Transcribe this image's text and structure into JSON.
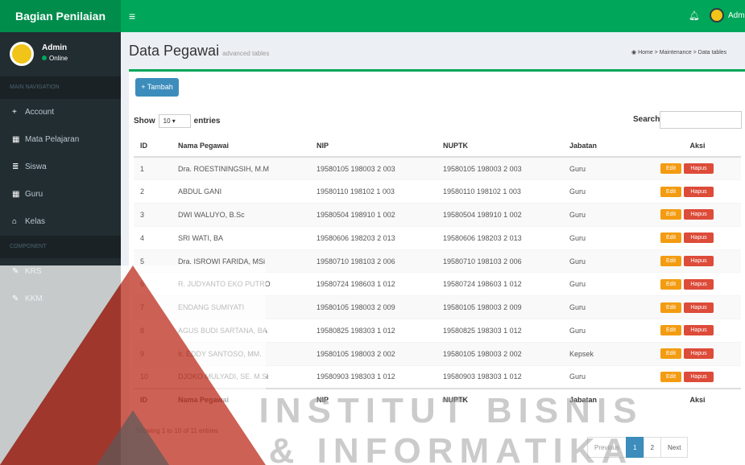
{
  "brand": "Bagian Penilaian",
  "top_user": "Admin",
  "sidebar": {
    "user_name": "Admin",
    "user_status": "Online",
    "header_main": "MAIN NAVIGATION",
    "header_component": "COMPONENT",
    "items": [
      {
        "label": "Account",
        "icon": "user-plus-icon",
        "glyph": "+"
      },
      {
        "label": "Mata Pelajaran",
        "icon": "table-icon",
        "glyph": "▦"
      },
      {
        "label": "Siswa",
        "icon": "list-icon",
        "glyph": "≣"
      },
      {
        "label": "Guru",
        "icon": "grid-icon",
        "glyph": "▦"
      },
      {
        "label": "Kelas",
        "icon": "home-icon",
        "glyph": "⌂"
      },
      {
        "label": "KRS",
        "icon": "edit-icon",
        "glyph": "✎"
      },
      {
        "label": "KKM",
        "icon": "edit-icon",
        "glyph": "✎"
      }
    ]
  },
  "page": {
    "title": "Data Pegawai",
    "subtitle": "advanced tables",
    "breadcrumb": "Home > Maintenance > Data tables"
  },
  "toolbar": {
    "add_label": "Tambah"
  },
  "table_controls": {
    "show": "Show",
    "length": "10",
    "entries": "entries",
    "search_label": "Search:"
  },
  "table": {
    "columns": [
      "ID",
      "Nama Pegawai",
      "NIP",
      "NUPTK",
      "Jabatan",
      "Aksi"
    ],
    "edit_label": "Edit",
    "delete_label": "Hapus",
    "rows": [
      {
        "id": "1",
        "nama": "Dra. ROESTININGSIH, M.M",
        "nip": "19580105 198003 2 003",
        "nuptk": "19580105 198003 2 003",
        "jabatan": "Guru"
      },
      {
        "id": "2",
        "nama": "ABDUL GANI",
        "nip": "19580110 198102 1 003",
        "nuptk": "19580110 198102 1 003",
        "jabatan": "Guru"
      },
      {
        "id": "3",
        "nama": "DWI WALUYO, B.Sc",
        "nip": "19580504 198910 1 002",
        "nuptk": "19580504 198910 1 002",
        "jabatan": "Guru"
      },
      {
        "id": "4",
        "nama": "SRI WATI, BA",
        "nip": "19580606 198203 2 013",
        "nuptk": "19580606 198203 2 013",
        "jabatan": "Guru"
      },
      {
        "id": "5",
        "nama": "Dra. ISROWI FARIDA, MSi",
        "nip": "19580710 198103 2 006",
        "nuptk": "19580710 198103 2 006",
        "jabatan": "Guru"
      },
      {
        "id": "6",
        "nama": "R. JUDYANTO EKO PUTRO",
        "nip": "19580724 198603 1 012",
        "nuptk": "19580724 198603 1 012",
        "jabatan": "Guru"
      },
      {
        "id": "7",
        "nama": "ENDANG SUMIYATI",
        "nip": "19580105 198003 2 009",
        "nuptk": "19580105 198003 2 009",
        "jabatan": "Guru"
      },
      {
        "id": "8",
        "nama": "AGUS BUDI SARTANA, BA",
        "nip": "19580825 198303 1 012",
        "nuptk": "19580825 198303 1 012",
        "jabatan": "Guru"
      },
      {
        "id": "9",
        "nama": "Ir. EDDY SANTOSO, MM.",
        "nip": "19580105 198003 2 002",
        "nuptk": "19580105 198003 2 002",
        "jabatan": "Kepsek"
      },
      {
        "id": "10",
        "nama": "DJOKO MULYADI, SE. M.Si",
        "nip": "19580903 198303 1 012",
        "nuptk": "19580903 198303 1 012",
        "jabatan": "Guru"
      }
    ]
  },
  "info": "Showing 1 to 10 of 11 entries",
  "pagination": {
    "previous": "Previous",
    "pages": [
      "1",
      "2"
    ],
    "next": "Next"
  },
  "watermark": {
    "line1": "INSTITUT BISNIS",
    "line2": "& INFORMATIKA"
  },
  "colors": {
    "primary_green": "#00a65a",
    "sidebar": "#222d32",
    "edit": "#f39c12",
    "delete": "#dd4b39",
    "add": "#3c8dbc",
    "watermark_red": "#c0392b"
  }
}
